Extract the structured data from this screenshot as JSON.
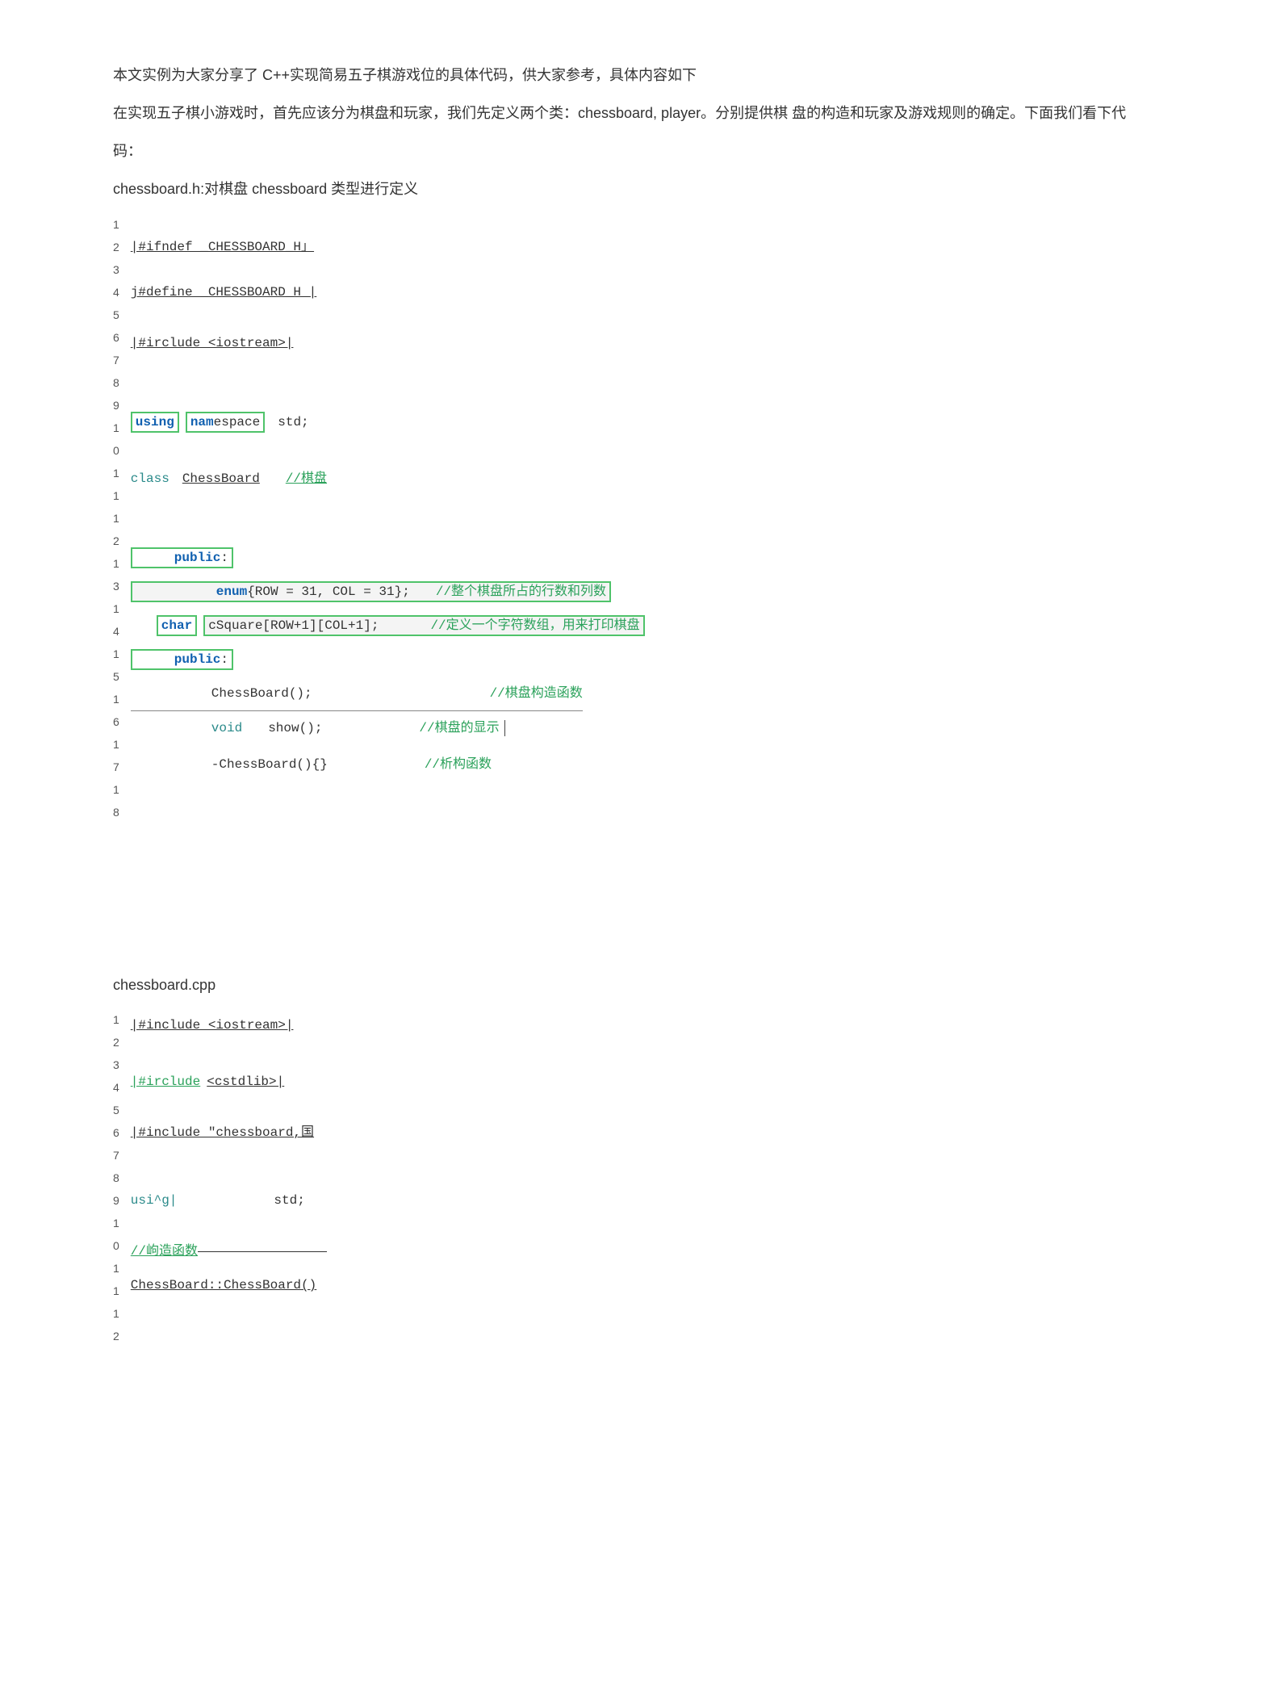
{
  "intro": {
    "p1": "本文实例为大家分享了 C++实现简易五子棋游戏位的具体代码，供大家参考，具体内容如下",
    "p2": "在实现五子棋小游戏时，首先应该分为棋盘和玩家，我们先定义两个类：chessboard, player。分别提供棋 盘的构造和玩家及游戏规则的确定。下面我们看下代码："
  },
  "section1": {
    "title_prefix": "chessboard.h:",
    "title_rest": "对棋盘 chessboard 类型进行定义"
  },
  "code1": {
    "gutter": [
      "1",
      "2",
      "3",
      "4",
      "5",
      "6",
      "7",
      "8",
      "9",
      "1",
      "0",
      "1",
      "1",
      "1",
      "2",
      "1",
      "3",
      "1",
      "4",
      "1",
      "5",
      "1",
      "6",
      "1",
      "7",
      "1",
      "8"
    ],
    "l2": "|#ifndef _CHESSBOARD_H」",
    "l4": "j#define _CHESSBOARD_H_|",
    "l6": "|#irclude <iostream>|",
    "l9a": "using",
    "l9bfull": "namespace",
    "l9c": "std;",
    "l11a": "class",
    "l11b": "ChessBoard",
    "l11c": "//棋盘",
    "l13a": "public",
    "l13b": ":",
    "l14a": "enum",
    "l14b": "{ROW = 31, COL = 31};",
    "l14c": "//整个棋盘所占的行数和列数",
    "l15a": "char",
    "l15b": "cSquare[ROW+1][COL+1];",
    "l15c": "//定义一个字符数组，用来打印棋盘",
    "l16a": "public",
    "l16b": ":",
    "l17a": "ChessBoard();",
    "l17c": "//棋盘构造函数",
    "l18a": "void",
    "l18b": "show();",
    "l18c": "//棋盘的显示",
    "l19a": "-ChessBoard(){}",
    "l19c": "//析构函数"
  },
  "section2": {
    "title": "chessboard.cpp"
  },
  "code2": {
    "gutter": [
      "1",
      "2",
      "3",
      "4",
      "5",
      "6",
      "7",
      "8",
      "9",
      "1",
      "0",
      "1",
      "1",
      "1",
      "2"
    ],
    "l1": "|#include <iostream>|",
    "l3a": "|#irclude",
    "l3b": "<cstdlib>|",
    "l5": "|#include \"chessboard,国",
    "l8a": "usi^g|",
    "l8b": "std;",
    "l10": "//岣造函数",
    "l11": "ChessBoard::ChessBoard()"
  }
}
